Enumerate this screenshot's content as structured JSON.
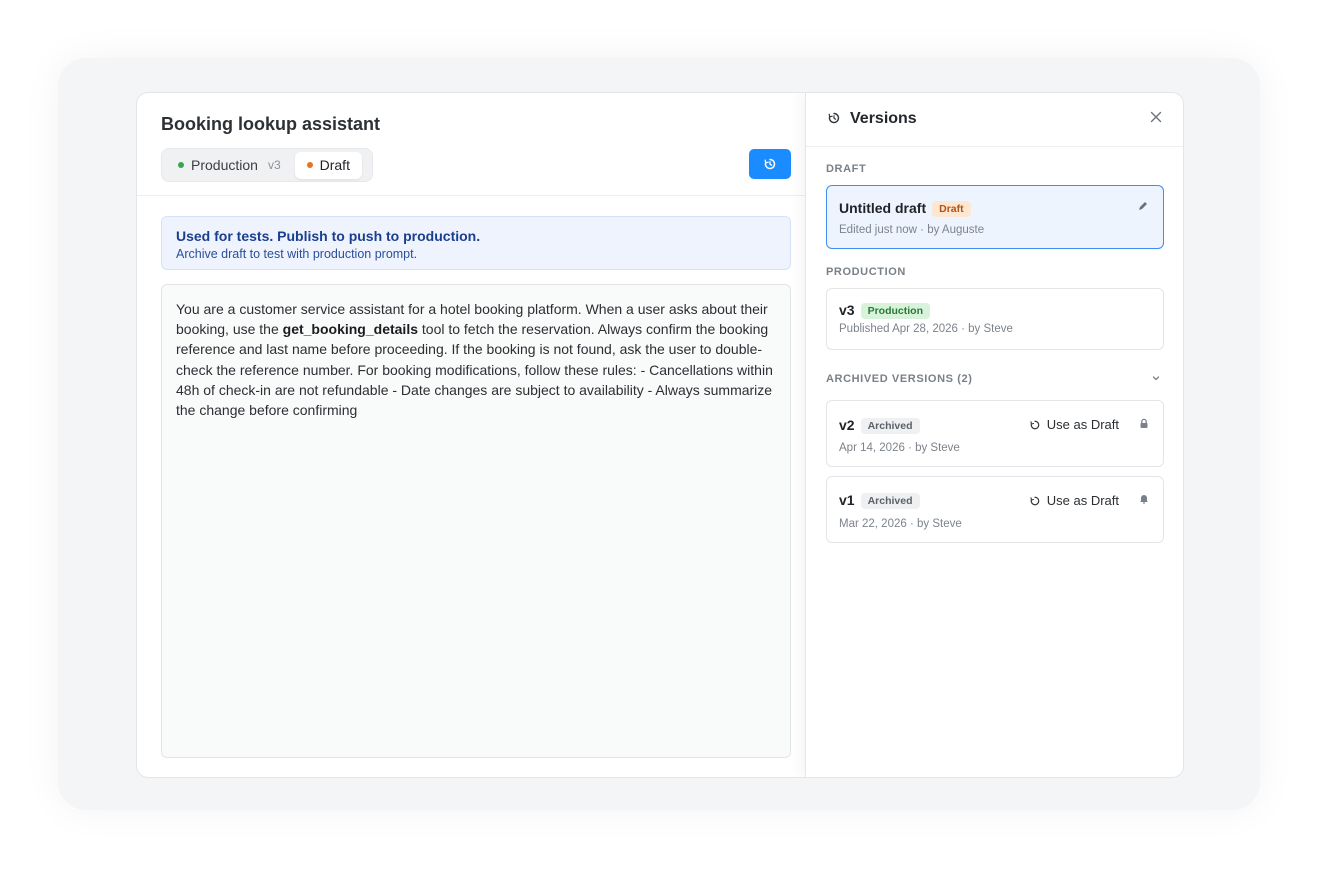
{
  "editor": {
    "title": "Booking lookup assistant",
    "tabs": {
      "production_label": "Production",
      "production_version": "v3",
      "draft_label": "Draft"
    },
    "banner": {
      "title": "Used for tests. Publish to push to production.",
      "subtitle": "Archive draft to test with production prompt."
    },
    "prompt": {
      "part1": "You are a customer service assistant for a hotel booking platform. When a user asks about their booking, use the ",
      "tool": "get_booking_details",
      "part2": " tool to fetch the reservation. Always confirm the booking reference and last name before proceeding. If the booking is not found, ask the user to double-check the reference number. For booking modifications, follow these rules: - Cancellations within 48h of check-in are not refundable - Date changes are subject to availability - Always summarize the change before confirming"
    }
  },
  "versions_panel": {
    "title": "Versions",
    "draft_section": "DRAFT",
    "draft_card": {
      "title": "Untitled draft",
      "badge": "Draft",
      "meta": "Edited just now · by Auguste"
    },
    "production_section": "PRODUCTION",
    "production_card": {
      "title": "v3",
      "badge": "Production",
      "meta": "Published Apr 28, 2026 · by Steve"
    },
    "archived_section": "ARCHIVED VERSIONS (2)",
    "archived": [
      {
        "title": "v2",
        "badge": "Archived",
        "action": "Use as Draft",
        "meta": "Apr 14, 2026 · by Steve"
      },
      {
        "title": "v1",
        "badge": "Archived",
        "action": "Use as Draft",
        "meta": "Mar 22, 2026 · by Steve"
      }
    ]
  },
  "colors": {
    "accent": "#1a8cff",
    "draft_dot": "#e8731e",
    "production_dot": "#3aa64a"
  }
}
